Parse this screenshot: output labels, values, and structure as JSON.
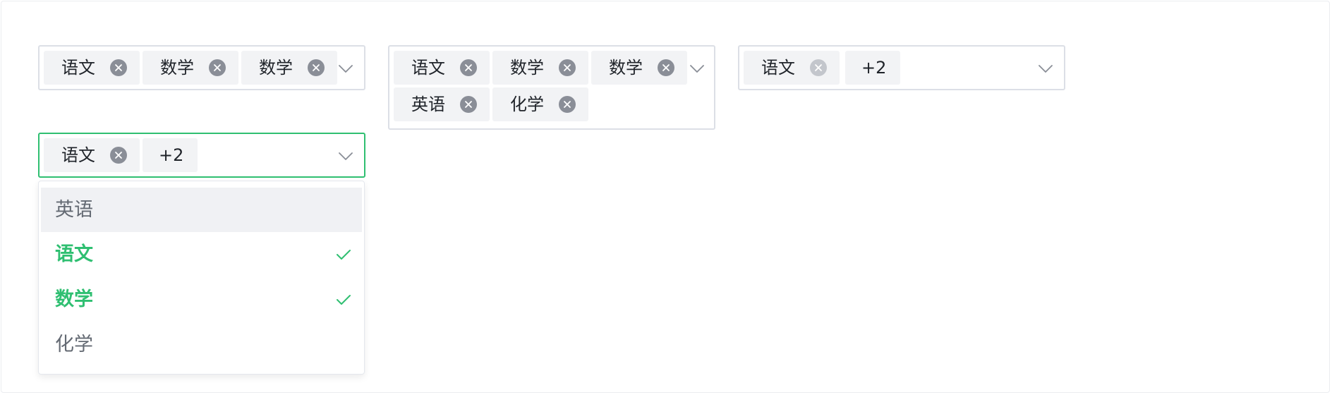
{
  "colors": {
    "accent": "#2fbf71",
    "border": "#dcdfe6",
    "tag_bg": "#f2f3f5",
    "hover_bg": "#f0f1f4"
  },
  "select1": {
    "tags": [
      {
        "label": "语文"
      },
      {
        "label": "数学"
      },
      {
        "label": "数学"
      }
    ]
  },
  "select2": {
    "tags": [
      {
        "label": "语文"
      },
      {
        "label": "数学"
      },
      {
        "label": "数学"
      },
      {
        "label": "英语"
      },
      {
        "label": "化学"
      }
    ]
  },
  "select3": {
    "tags": [
      {
        "label": "语文"
      }
    ],
    "more_label": "+2"
  },
  "select4": {
    "tags": [
      {
        "label": "语文"
      }
    ],
    "more_label": "+2",
    "dropdown": {
      "options": [
        {
          "label": "英语",
          "selected": false
        },
        {
          "label": "语文",
          "selected": true
        },
        {
          "label": "数学",
          "selected": true
        },
        {
          "label": "化学",
          "selected": false
        }
      ]
    }
  },
  "icons": {
    "tag_close": "close-circle-icon",
    "arrow": "chevron-down-icon",
    "check": "check-icon"
  }
}
